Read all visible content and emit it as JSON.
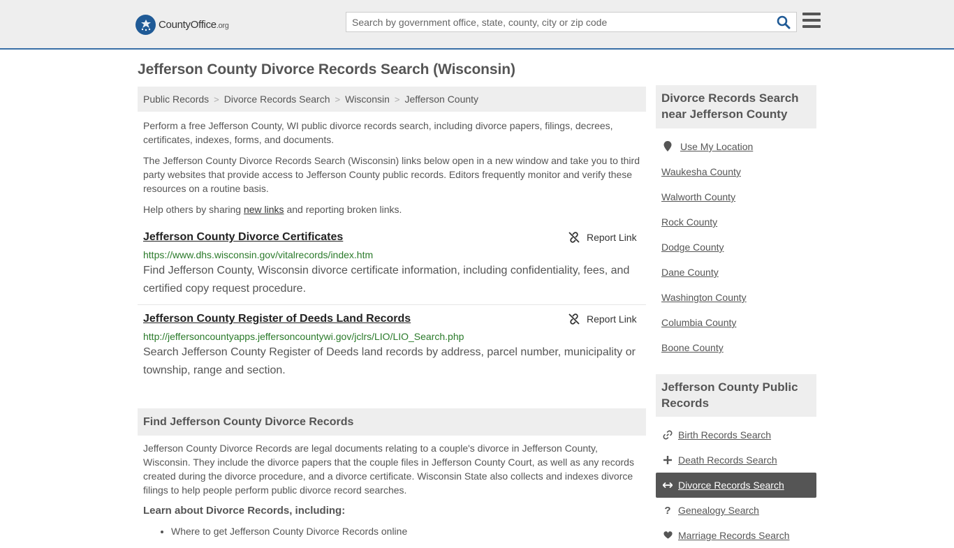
{
  "header": {
    "logo_main": "CountyOffice",
    "logo_suffix": ".org",
    "search_placeholder": "Search by government office, state, county, city or zip code"
  },
  "page_title": "Jefferson County Divorce Records Search (Wisconsin)",
  "breadcrumb": [
    "Public Records",
    "Divorce Records Search",
    "Wisconsin",
    "Jefferson County"
  ],
  "intro": {
    "p1": "Perform a free Jefferson County, WI public divorce records search, including divorce papers, filings, decrees, certificates, indexes, forms, and documents.",
    "p2": "The Jefferson County Divorce Records Search (Wisconsin) links below open in a new window and take you to third party websites that provide access to Jefferson County public records. Editors frequently monitor and verify these resources on a routine basis.",
    "p3_before": "Help others by sharing ",
    "p3_link": "new links",
    "p3_after": " and reporting broken links."
  },
  "results": [
    {
      "title": "Jefferson County Divorce Certificates",
      "report": "Report Link",
      "url": "https://www.dhs.wisconsin.gov/vitalrecords/index.htm",
      "description": "Find Jefferson County, Wisconsin divorce certificate information, including confidentiality, fees, and certified copy request procedure."
    },
    {
      "title": "Jefferson County Register of Deeds Land Records",
      "report": "Report Link",
      "url": "http://jeffersoncountyapps.jeffersoncountywi.gov/jclrs/LIO/LIO_Search.php",
      "description": "Search Jefferson County Register of Deeds land records by address, parcel number, municipality or township, range and section."
    }
  ],
  "find_section": {
    "heading": "Find Jefferson County Divorce Records",
    "body": "Jefferson County Divorce Records are legal documents relating to a couple's divorce in Jefferson County, Wisconsin. They include the divorce papers that the couple files in Jefferson County Court, as well as any records created during the divorce procedure, and a divorce certificate. Wisconsin State also collects and indexes divorce filings to help people perform public divorce record searches.",
    "learn_heading": "Learn about Divorce Records, including:",
    "learn_items": [
      "Where to get Jefferson County Divorce Records online"
    ]
  },
  "sidebar": {
    "nearby_heading": "Divorce Records Search near Jefferson County",
    "use_location": "Use My Location",
    "nearby": [
      "Waukesha County",
      "Walworth County",
      "Rock County",
      "Dodge County",
      "Dane County",
      "Washington County",
      "Columbia County",
      "Boone County"
    ],
    "public_heading": "Jefferson County Public Records",
    "public_items": [
      {
        "label": "Birth Records Search",
        "icon": "link-icon"
      },
      {
        "label": "Death Records Search",
        "icon": "plus-icon"
      },
      {
        "label": "Divorce Records Search",
        "icon": "arrows-horizontal-icon"
      },
      {
        "label": "Genealogy Search",
        "icon": "question-icon"
      },
      {
        "label": "Marriage Records Search",
        "icon": "heart-icon"
      }
    ]
  }
}
